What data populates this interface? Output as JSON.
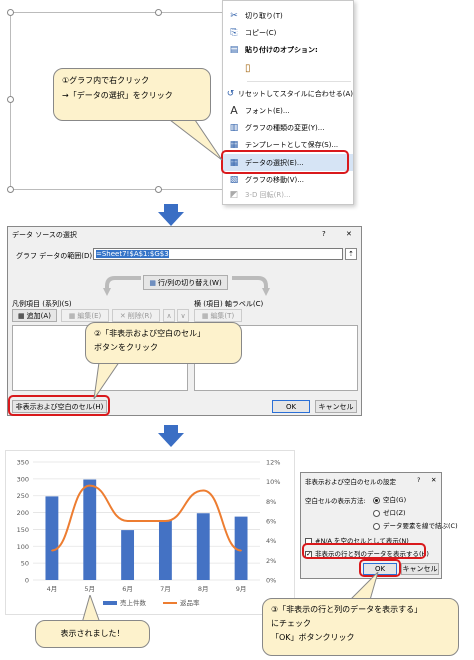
{
  "context_menu": {
    "items": [
      {
        "icon": "scissors-icon",
        "glyph": "✂",
        "label": "切り取り(T)"
      },
      {
        "icon": "copy-icon",
        "glyph": "⎘",
        "label": "コピー(C)"
      },
      {
        "icon": "paste-icon",
        "glyph": "📋",
        "label": "貼り付けのオプション:"
      },
      {
        "icon": "paste-option-icon",
        "glyph": "📄",
        "label": ""
      },
      {
        "icon": "reset-style-icon",
        "glyph": "↺",
        "label": "リセットしてスタイルに合わせる(A)"
      },
      {
        "icon": "font-icon",
        "glyph": "A",
        "label": "フォント(E)..."
      },
      {
        "icon": "change-chart-type-icon",
        "glyph": "▥",
        "label": "グラフの種類の変更(Y)..."
      },
      {
        "icon": "save-template-icon",
        "glyph": "▦",
        "label": "テンプレートとして保存(S)..."
      },
      {
        "icon": "select-data-icon",
        "glyph": "▦",
        "label": "データの選択(E)..."
      },
      {
        "icon": "move-chart-icon",
        "glyph": "▧",
        "label": "グラフの移動(V)..."
      },
      {
        "icon": "rotate-3d-icon",
        "glyph": "◩",
        "label": "3-D 回転(R)..."
      }
    ]
  },
  "callout1": {
    "line1": "①グラフ内で右クリック",
    "line2": "→「データの選択」をクリック"
  },
  "dialog_select_source": {
    "title": "データ ソースの選択",
    "help": "?",
    "close": "✕",
    "range_label": "グラフ データの範囲(D):",
    "range_value": "=Sheet7!$A$1:$G$3",
    "switch_button": "行/列の切り替え(W)",
    "legend_header": "凡例項目 (系列)(S)",
    "axis_header": "横 (項目) 軸ラベル(C)",
    "add_button": "追加(A)",
    "edit_button": "編集(E)",
    "delete_button": "削除(R)",
    "axis_edit_button": "編集(T)",
    "hidden_cells_button": "非表示および空白のセル(H)",
    "ok": "OK",
    "cancel": "キャンセル"
  },
  "callout2": {
    "line1": "②「非表示および空白のセル」",
    "line2": "ボタンをクリック"
  },
  "chart_data": {
    "type": "bar",
    "categories": [
      "4月",
      "5月",
      "6月",
      "7月",
      "8月",
      "9月"
    ],
    "series": [
      {
        "name": "売上件数",
        "type": "bar",
        "values": [
          248,
          298,
          148,
          178,
          198,
          188
        ],
        "axis": "left",
        "color": "#4472c4"
      },
      {
        "name": "返品率",
        "type": "line",
        "values": [
          3,
          9.6,
          6,
          6,
          9.1,
          3
        ],
        "axis": "right",
        "color": "#ed7d31"
      }
    ],
    "y_left_ticks": [
      "350",
      "300",
      "250",
      "200",
      "150",
      "100",
      "50",
      "0"
    ],
    "y_right_ticks": [
      "12%",
      "10%",
      "8%",
      "6%",
      "4%",
      "2%",
      "0%"
    ],
    "ylim_left": [
      0,
      350
    ],
    "ylim_right": [
      0,
      12
    ],
    "legend_position": "bottom",
    "grid": true
  },
  "dialog_hidden_cells": {
    "title": "非表示および空白のセルの設定",
    "help": "?",
    "close": "✕",
    "empty_cells_label": "空白セルの表示方法:",
    "radio_gaps": "空白(G)",
    "radio_zero": "ゼロ(Z)",
    "radio_connect": "データ要素を線で結ぶ(C)",
    "na_checkbox": "#N/A を空のセルとして表示(N)",
    "hidden_checkbox": "非表示の行と列のデータを表示する(H)",
    "ok": "OK",
    "cancel": "キャンセル"
  },
  "callout3": {
    "line1": "③「非表示の行と列のデータを表示する」",
    "line2": "にチェック",
    "line3": "「OK」ボタンクリック"
  },
  "callout4": {
    "text": "表示されました！"
  }
}
